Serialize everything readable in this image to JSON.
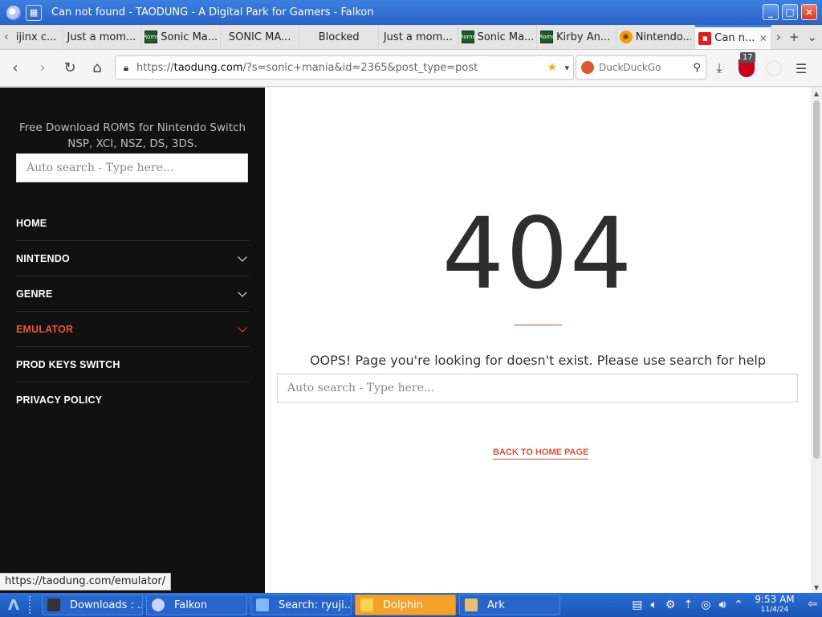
{
  "window": {
    "title": "Can not found - TAODUNG - A Digital Park for Gamers - Falkon",
    "controls": {
      "minimize": "_",
      "maximize": "□",
      "close": "×"
    }
  },
  "tabs": [
    {
      "label": "ijinx c...",
      "favicon": "none"
    },
    {
      "label": "Just a mom...",
      "favicon": "none"
    },
    {
      "label": "Sonic Ma...",
      "favicon": "roms"
    },
    {
      "label": "SONIC MA...",
      "favicon": "none"
    },
    {
      "label": "Blocked",
      "favicon": "none"
    },
    {
      "label": "Just a mom...",
      "favicon": "none"
    },
    {
      "label": "Sonic Ma...",
      "favicon": "roms"
    },
    {
      "label": "Kirby An...",
      "favicon": "roms"
    },
    {
      "label": "Nintendo...",
      "favicon": "nintendo"
    },
    {
      "label": "Can n...",
      "favicon": "red",
      "active": true
    }
  ],
  "tab_tools": {
    "left_arrow": "‹",
    "right_arrow": "›",
    "new_tab": "+",
    "menu": "⌄"
  },
  "navbar": {
    "url_prefix": "https://",
    "url_domain": "taodung.com",
    "url_rest": "/?s=sonic+mania&id=2365&post_type=post",
    "search_placeholder": "DuckDuckGo",
    "extension_badge": "17"
  },
  "site": {
    "tagline": "Free Download ROMS for Nintendo Switch NSP, XCI, NSZ, DS, 3DS.",
    "search_placeholder": "Auto search - Type here...",
    "menu": [
      {
        "label": "HOME",
        "has_submenu": false,
        "highlight": false
      },
      {
        "label": "NINTENDO",
        "has_submenu": true,
        "highlight": false
      },
      {
        "label": "GENRE",
        "has_submenu": true,
        "highlight": false
      },
      {
        "label": "EMULATOR",
        "has_submenu": true,
        "highlight": true
      },
      {
        "label": "PROD KEYS SWITCH",
        "has_submenu": false,
        "highlight": false
      },
      {
        "label": "PRIVACY POLICY",
        "has_submenu": false,
        "highlight": false
      }
    ],
    "error_code": "404",
    "error_message": "OOPS! Page you're looking for doesn't exist. Please use search for help",
    "main_search_placeholder": "Auto search - Type here...",
    "back_link": "BACK TO HOME PAGE",
    "accent_color": "#e8543a"
  },
  "status_url": "https://taodung.com/emulator/",
  "taskbar": {
    "tasks": [
      {
        "label": "Downloads : ...",
        "icon": "terminal-icon",
        "active": false
      },
      {
        "label": "Falkon",
        "icon": "falkon-icon",
        "active": false
      },
      {
        "label": "Search: ryuji...",
        "icon": "search-app-icon",
        "active": false
      },
      {
        "label": "Dolphin",
        "icon": "folder-icon",
        "active": true
      },
      {
        "label": "Ark",
        "icon": "archive-icon",
        "active": false
      }
    ],
    "time": "9:53 AM",
    "date": "11/4/24"
  }
}
